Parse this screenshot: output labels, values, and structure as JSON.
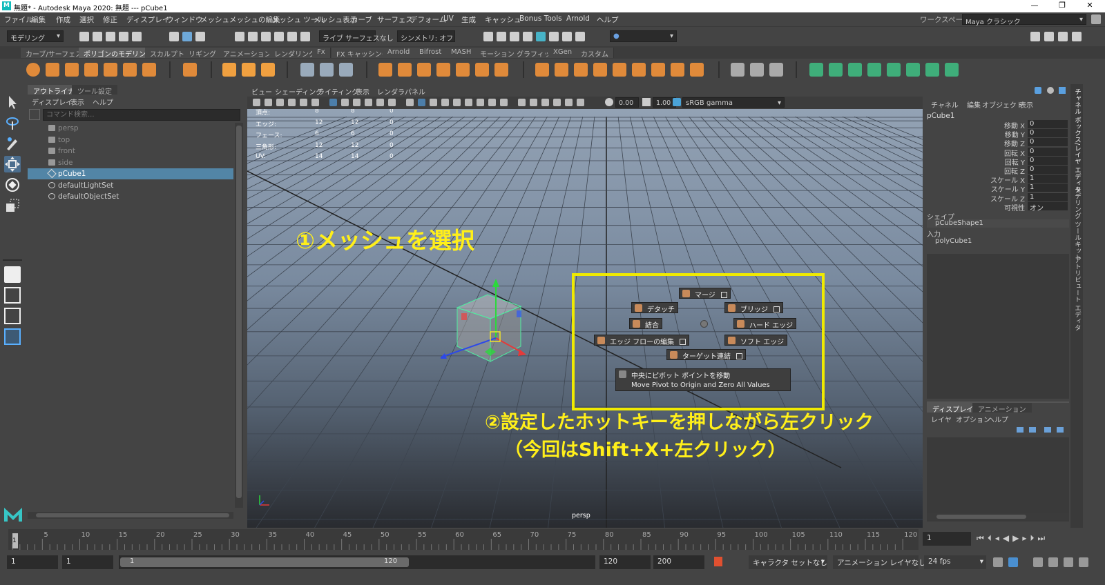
{
  "window": {
    "title": "無題* - Autodesk Maya 2020: 無題   ---   pCube1",
    "logo": "M"
  },
  "menu": [
    "ファイル",
    "編集",
    "作成",
    "選択",
    "修正",
    "ディスプレイ",
    "ウィンドウ",
    "メッシュ",
    "メッシュの編集",
    "メッシュ ツール",
    "メッシュ表示",
    "カーブ",
    "サーフェス",
    "デフォーム",
    "UV",
    "生成",
    "キャッシュ",
    "Bonus Tools",
    "Arnold",
    "ヘルプ"
  ],
  "workspace": {
    "label": "ワークスペース :",
    "value": "Maya クラシック"
  },
  "statusline": {
    "mode": "モデリング",
    "live": "ライブ サーフェスなし",
    "symmetry": "シンメトリ: オフ"
  },
  "shelf_tabs": [
    "カーブ/サーフェス",
    "ポリゴンのモデリング",
    "スカルプト",
    "リギング",
    "アニメーション",
    "レンダリング",
    "Fx",
    "FX キャッシング",
    "Arnold",
    "Bifrost",
    "MASH",
    "モーション グラフィックス",
    "XGen",
    "カスタム"
  ],
  "active_shelf_tab": "ポリゴンのモデリング",
  "outliner": {
    "tabs": [
      "アウトライナ",
      "ツール設定"
    ],
    "menu": [
      "ディスプレイ",
      "表示",
      "ヘルプ"
    ],
    "search_placeholder": "コマンド検索...",
    "items": [
      {
        "label": "persp",
        "icon": "camera-icon",
        "dim": true
      },
      {
        "label": "top",
        "icon": "camera-icon",
        "dim": true
      },
      {
        "label": "front",
        "icon": "camera-icon",
        "dim": true
      },
      {
        "label": "side",
        "icon": "camera-icon",
        "dim": true
      },
      {
        "label": "pCube1",
        "icon": "mesh-icon",
        "selected": true
      },
      {
        "label": "defaultLightSet",
        "icon": "set-icon"
      },
      {
        "label": "defaultObjectSet",
        "icon": "set-icon"
      }
    ]
  },
  "viewport": {
    "menu": [
      "ビュー",
      "シェーディング",
      "ライティング",
      "表示",
      "レンダラ",
      "パネル"
    ],
    "near": "0.00",
    "far": "1.00",
    "colorspace": "sRGB gamma",
    "camera_label": "persp",
    "hud": [
      {
        "label": "頂点:",
        "a": "8",
        "b": "8",
        "c": "0"
      },
      {
        "label": "エッジ:",
        "a": "12",
        "b": "12",
        "c": "0"
      },
      {
        "label": "フェース:",
        "a": "6",
        "b": "6",
        "c": "0"
      },
      {
        "label": "三角形:",
        "a": "12",
        "b": "12",
        "c": "0"
      },
      {
        "label": "UV:",
        "a": "14",
        "b": "14",
        "c": "0"
      }
    ]
  },
  "marking_menu": {
    "items": {
      "merge": "マージ",
      "detach": "デタッチ",
      "bridge": "ブリッジ",
      "combine": "結合",
      "hard_edge": "ハード エッジ",
      "edit_edge_flow": "エッジ フローの編集",
      "soft_edge": "ソフト エッジ",
      "target_weld": "ターゲット連結",
      "center_pivot_1": "中央にピボット ポイントを移動",
      "center_pivot_2": "Move Pivot to Origin and Zero All Values"
    }
  },
  "annotations": {
    "step1": "①メッシュを選択",
    "step2": "②設定したホットキーを押しながら左クリック",
    "step2b": "（今回はShift+X+左クリック）"
  },
  "channel_box": {
    "menu": [
      "チャネル",
      "編集",
      "オブジェクト",
      "表示"
    ],
    "object": "pCube1",
    "attrs": [
      {
        "k": "移動 X",
        "v": "0"
      },
      {
        "k": "移動 Y",
        "v": "0"
      },
      {
        "k": "移動 Z",
        "v": "0"
      },
      {
        "k": "回転 X",
        "v": "0"
      },
      {
        "k": "回転 Y",
        "v": "0"
      },
      {
        "k": "回転 Z",
        "v": "0"
      },
      {
        "k": "スケール X",
        "v": "1"
      },
      {
        "k": "スケール Y",
        "v": "1"
      },
      {
        "k": "スケール Z",
        "v": "1"
      },
      {
        "k": "可視性",
        "v": "オン"
      }
    ],
    "shapes_label": "シェイプ",
    "shape": "pCubeShape1",
    "inputs_label": "入力",
    "input": "polyCube1",
    "layer_tabs": [
      "ディスプレイ",
      "アニメーション"
    ],
    "layer_menu": [
      "レイヤ",
      "オプション",
      "ヘルプ"
    ]
  },
  "side_tabs": [
    "チャネル ボックス/レイヤ エディタ",
    "モデリング ツールキット",
    "アトリビュート エディタ"
  ],
  "timeline": {
    "ticks": [
      "5",
      "10",
      "15",
      "20",
      "25",
      "30",
      "35",
      "40",
      "45",
      "50",
      "55",
      "60",
      "65",
      "70",
      "75",
      "80",
      "85",
      "90",
      "95",
      "100",
      "105",
      "110",
      "115",
      "120"
    ],
    "current": "1",
    "current_frame_field": "1"
  },
  "range": {
    "start": "1",
    "start_inner": "1",
    "slider_start": "1",
    "slider_end": "120",
    "end_inner": "120",
    "end": "200",
    "character_set": "キャラクタ セットなし",
    "anim_layer": "アニメーション レイヤなし",
    "fps": "24 fps"
  }
}
